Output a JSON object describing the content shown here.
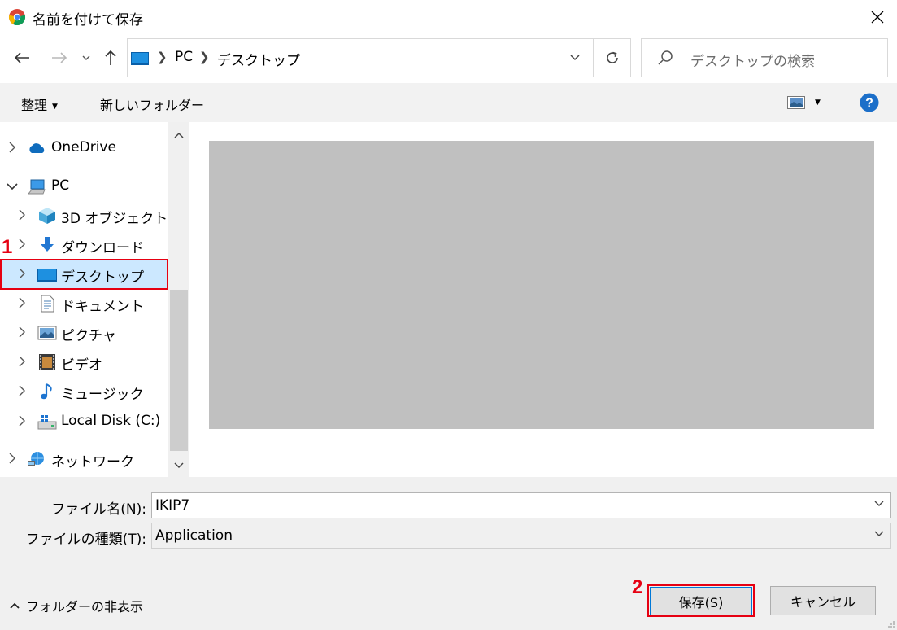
{
  "window": {
    "title": "名前を付けて保存"
  },
  "nav": {
    "breadcrumb": [
      "PC",
      "デスクトップ"
    ],
    "search_placeholder": "デスクトップの検索"
  },
  "toolbar": {
    "organize": "整理",
    "new_folder": "新しいフォルダー"
  },
  "sidebar": {
    "items": [
      {
        "label": "OneDrive",
        "icon": "cloud-icon"
      },
      {
        "label": "PC",
        "icon": "computer-icon"
      },
      {
        "label": "3D オブジェクト",
        "icon": "cube-icon"
      },
      {
        "label": "ダウンロード",
        "icon": "download-icon"
      },
      {
        "label": "デスクトップ",
        "icon": "desktop-icon",
        "selected": true
      },
      {
        "label": "ドキュメント",
        "icon": "document-icon"
      },
      {
        "label": "ピクチャ",
        "icon": "picture-icon"
      },
      {
        "label": "ビデオ",
        "icon": "video-icon"
      },
      {
        "label": "ミュージック",
        "icon": "music-icon"
      },
      {
        "label": "Local Disk (C:)",
        "icon": "disk-icon"
      },
      {
        "label": "ネットワーク",
        "icon": "network-icon"
      }
    ]
  },
  "annotations": {
    "marker1": "1",
    "marker2": "2"
  },
  "form": {
    "filename_label": "ファイル名(N):",
    "filename_value": "IKIP7",
    "filetype_label": "ファイルの種類(T):",
    "filetype_value": "Application"
  },
  "footer": {
    "hide_folders": "フォルダーの非表示",
    "save_button": "保存(S)",
    "cancel_button": "キャンセル"
  },
  "colors": {
    "selection": "#cce8ff",
    "highlight_red": "#e60012",
    "accent_blue": "#0078d7"
  }
}
